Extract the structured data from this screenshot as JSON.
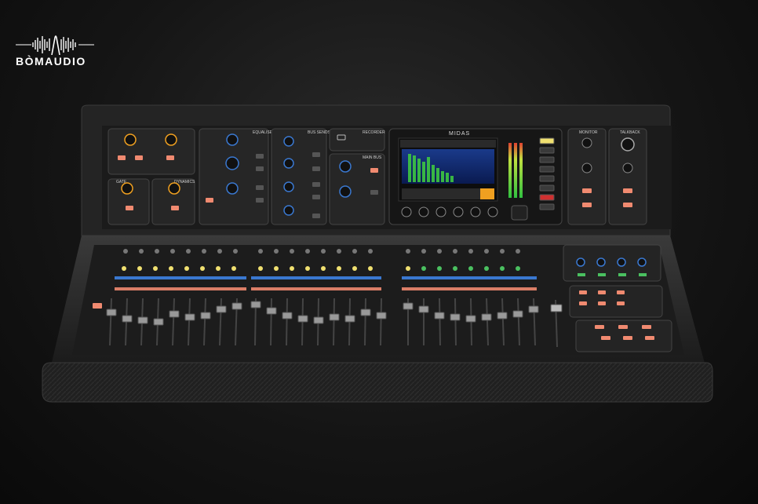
{
  "logo": {
    "text": "BÒMAUDIO"
  },
  "panel": {
    "section_titles": [
      "EQUALISER",
      "BUS SENDS",
      "RECORDER",
      "MAIN BUS",
      "MONITOR",
      "TALKBACK",
      "GATE",
      "DYNAMICS"
    ],
    "brand": "MIDAS"
  },
  "colors": {
    "background": "#151515",
    "chassis": "#2b2b2b",
    "panel": "#1f1f1f",
    "knob_ring": "#f0a020",
    "button_salmon": "#f08a70",
    "button_yellow": "#f0e070",
    "button_blue": "#3a78d0",
    "button_green": "#4ac060",
    "screen_green": "#40d040"
  },
  "icons": [
    "waveform-icon",
    "usb-icon",
    "xlr-socket-icon"
  ]
}
